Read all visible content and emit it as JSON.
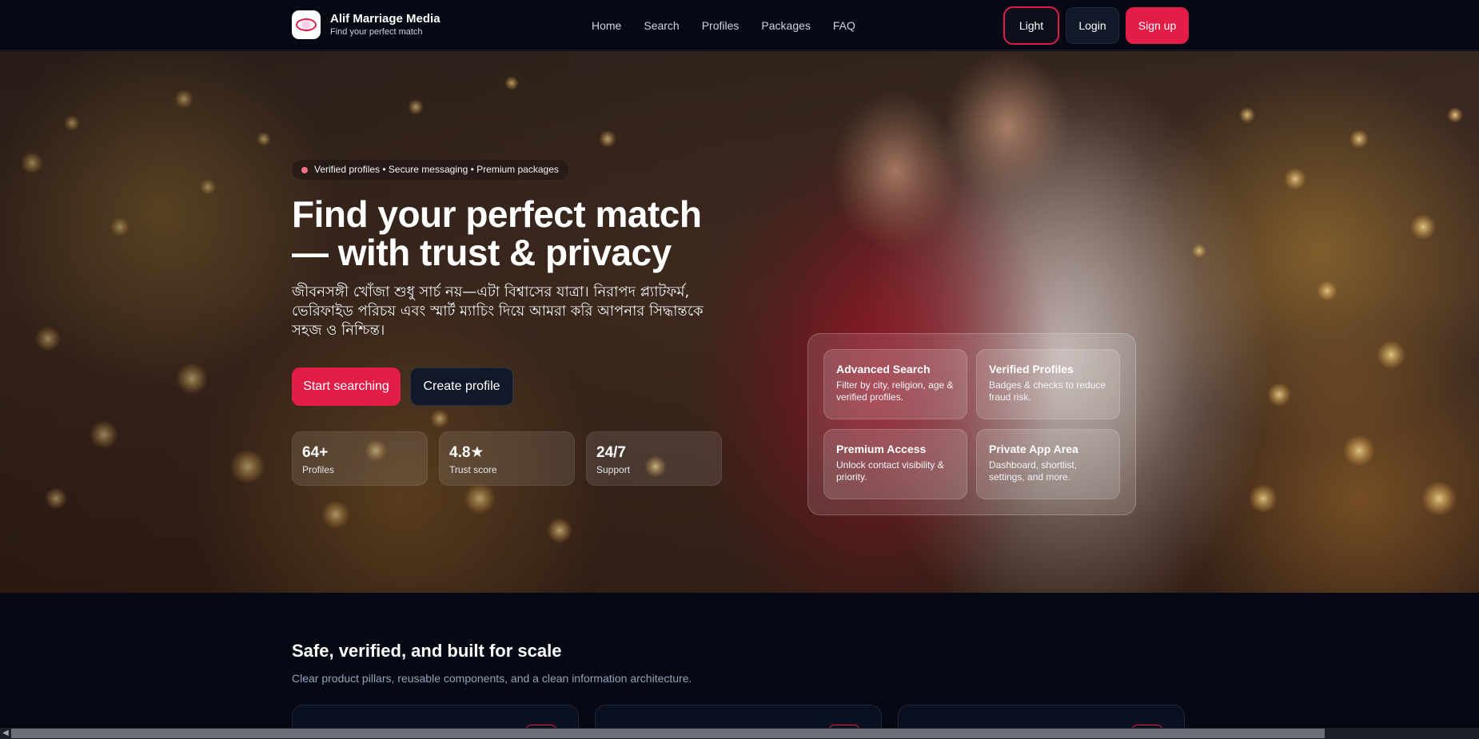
{
  "brand": {
    "name": "Alif Marriage Media",
    "tagline": "Find your perfect match"
  },
  "nav": {
    "links": [
      "Home",
      "Search",
      "Profiles",
      "Packages",
      "FAQ"
    ]
  },
  "actions": {
    "theme_label": "Light",
    "login_label": "Login",
    "signup_label": "Sign up"
  },
  "hero": {
    "pill": "Verified profiles • Secure messaging • Premium packages",
    "title": "Find your perfect match — with trust & privacy",
    "subtitle": "জীবনসঙ্গী খোঁজা শুধু সার্চ নয়—এটা বিশ্বাসের যাত্রা। নিরাপদ প্ল্যাটফর্ম, ভেরিফাইড পরিচয় এবং স্মার্ট ম্যাচিং দিয়ে আমরা করি আপনার সিদ্ধান্তকে সহজ ও নিশ্চিন্ত।",
    "primary_cta": "Start searching",
    "secondary_cta": "Create profile",
    "stats": [
      {
        "value": "64+",
        "label": "Profiles"
      },
      {
        "value": "4.8★",
        "label": "Trust score"
      },
      {
        "value": "24/7",
        "label": "Support"
      }
    ],
    "features": [
      {
        "title": "Advanced Search",
        "desc": "Filter by city, religion, age & verified profiles."
      },
      {
        "title": "Verified Profiles",
        "desc": "Badges & checks to reduce fraud risk."
      },
      {
        "title": "Premium Access",
        "desc": "Unlock contact visibility & priority."
      },
      {
        "title": "Private App Area",
        "desc": "Dashboard, shortlist, settings, and more."
      }
    ]
  },
  "section": {
    "title": "Safe, verified, and built for scale",
    "subtitle": "Clear product pillars, reusable components, and a clean information architecture."
  },
  "colors": {
    "accent": "#e11d48",
    "background": "#060914"
  }
}
